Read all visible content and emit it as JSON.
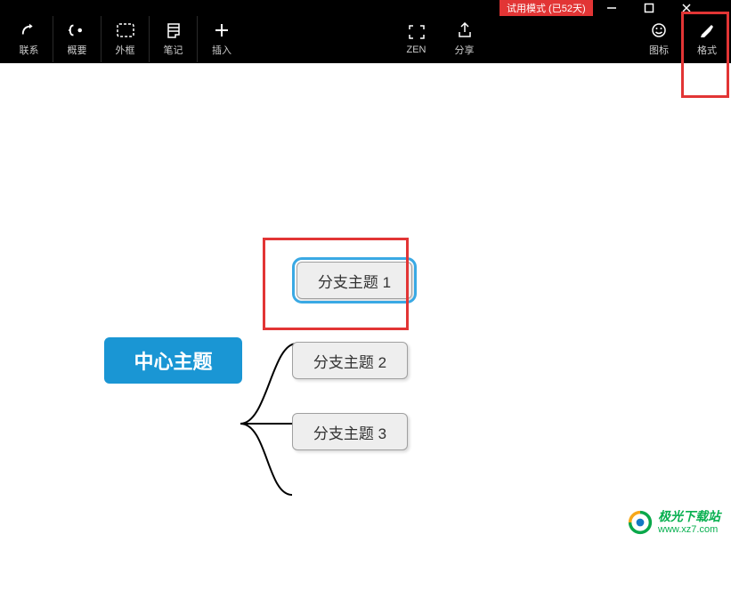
{
  "titlebar": {
    "trial_label": "试用模式 (已52天)"
  },
  "toolbar": {
    "relation": "联系",
    "summary": "概要",
    "boundary": "外框",
    "note": "笔记",
    "insert": "插入",
    "zen": "ZEN",
    "share": "分享",
    "icon_label": "图标",
    "format": "格式"
  },
  "mindmap": {
    "center": "中心主题",
    "branch1": "分支主题 1",
    "branch2": "分支主题 2",
    "branch3": "分支主题 3"
  },
  "watermark": {
    "line1": "极光下载站",
    "line2": "www.xz7.com"
  }
}
